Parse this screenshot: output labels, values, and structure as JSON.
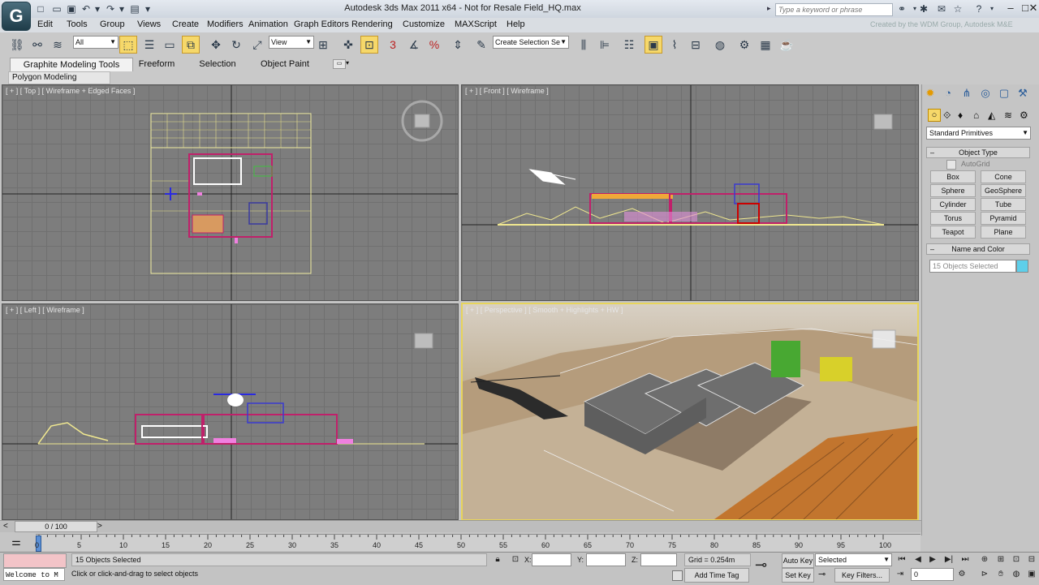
{
  "window": {
    "title": "Autodesk 3ds Max  2011 x64  -  Not for Resale   Field_HQ.max",
    "search_placeholder": "Type a keyword or phrase",
    "credit": "Created by the WDM Group, Autodesk M&E",
    "logo": "G"
  },
  "menu": [
    "Edit",
    "Tools",
    "Group",
    "Views",
    "Create",
    "Modifiers",
    "Animation",
    "Graph Editors",
    "Rendering",
    "Customize",
    "MAXScript",
    "Help"
  ],
  "toolbar": {
    "selection_filter": "All",
    "reference_coord": "View",
    "named_selection_placeholder": "Create Selection Se",
    "snap_toggle": "3",
    "angle_snap": "%"
  },
  "ribbon": {
    "tabs": [
      "Graphite Modeling Tools",
      "Freeform",
      "Selection",
      "Object Paint"
    ],
    "panel_label": "Polygon Modeling"
  },
  "viewports": {
    "top": "[ + ] [ Top ] [ Wireframe + Edged Faces ]",
    "front": "[ + ] [ Front ] [ Wireframe ]",
    "left": "[ + ] [ Left ] [ Wireframe ]",
    "perspective": "[ + ] [ Perspective ] [ Smooth + Highlights + HW ]"
  },
  "command_panel": {
    "category_dropdown": "Standard Primitives",
    "object_type_title": "Object Type",
    "autogrid_label": "AutoGrid",
    "primitives": [
      "Box",
      "Cone",
      "Sphere",
      "GeoSphere",
      "Cylinder",
      "Tube",
      "Torus",
      "Pyramid",
      "Teapot",
      "Plane"
    ],
    "name_color_title": "Name and Color",
    "name_field": "15 Objects Selected",
    "color_swatch": "#5ecfea"
  },
  "timeline": {
    "frame_readout": "0 / 100",
    "ticks": [
      "0",
      "5",
      "10",
      "15",
      "20",
      "25",
      "30",
      "35",
      "40",
      "45",
      "50",
      "55",
      "60",
      "65",
      "70",
      "75",
      "80",
      "85",
      "90",
      "95",
      "100"
    ]
  },
  "status": {
    "listener": "Welcome to M",
    "selected_text": "15 Objects Selected",
    "prompt": "Click or click-and-drag to select objects",
    "x_label": "X:",
    "y_label": "Y:",
    "z_label": "Z:",
    "grid": "Grid = 0.254m",
    "add_time_tag": "Add Time Tag",
    "auto_key": "Auto Key",
    "set_key": "Set Key",
    "selected_dropdown": "Selected",
    "key_filters": "Key Filters...",
    "frame_field": "0"
  }
}
